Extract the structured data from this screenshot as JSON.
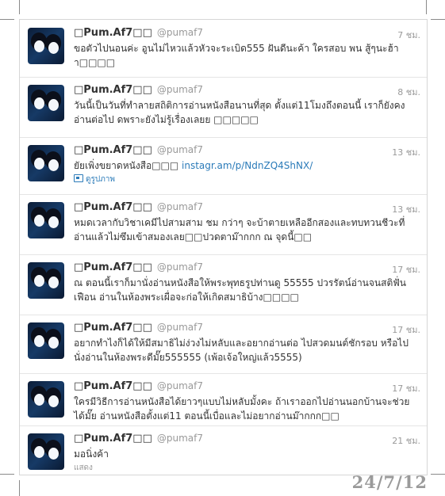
{
  "tweets": [
    {
      "name": "□Pum.Af7□□",
      "handle": "@pumaf7",
      "time": "7 ชม.",
      "text": "ขอตัวไปนอนค่ะ อูนไม่ไหวแล้วหัวจะระเบิด555 ฝันดีนะค้า ใครสอบ พน สู้ๆนะฮ้าา□□□□"
    },
    {
      "name": "□Pum.Af7□□",
      "handle": "@pumaf7",
      "time": "8 ชม.",
      "text": "วันนี้เป็นวันที่ทำลายสถิติการอ่านหนังสือนานที่สุด ตั้งแต่11โมงถึงตอนนี้ เราก็ยังคงอ่านต่อไป ดพราะยังไม่รู้เรื่องเลยย □□□□□"
    },
    {
      "name": "□Pum.Af7□□",
      "handle": "@pumaf7",
      "time": "13 ชม.",
      "text": "ยัยเพิ่งขยาดหนังสือ□□□ ",
      "link": "instagr.am/p/NdnZQ4ShNX/",
      "meta": "ดูรูปภาพ"
    },
    {
      "name": "□Pum.Af7□□",
      "handle": "@pumaf7",
      "time": "13 ชม.",
      "text": "หมดเวลากับวิชาเคมีไปสามสาม ชม กว่าๆ จะบ้าตายเหลืออีกสองและทบทวนชีวะที่อ่านแล้วไม่ซึมเข้าสมองเลย□□ปวดตาม๊ากกก ณ จุดนี้□□"
    },
    {
      "name": "□Pum.Af7□□",
      "handle": "@pumaf7",
      "time": "17 ชม.",
      "text": "ณ ตอนนี้เราก็มานั่งอ่านหนังสือให้พระพุทธรูปท่านดู 55555 ปวรรัตน์อ่านจนสติฟั่นเฟือน อ่านในห้องพระเผื่อจะก่อให้เกิดสมาธิบ้าง□□□□"
    },
    {
      "name": "□Pum.Af7□□",
      "handle": "@pumaf7",
      "time": "17 ชม.",
      "text": "อยากทำไงก็ได้ให้มีสมาธิไม่ง่วงไม่หลับและอยากอ่านต่อ ไปสวดมนต์ชักรอบ หรือไปนั่งอ่านในห้องพระดีมั๊ย555555 (เพ้อเจ้อใหญ่แล้ว5555)"
    },
    {
      "name": "□Pum.Af7□□",
      "handle": "@pumaf7",
      "time": "17 ชม.",
      "text": "ใครมีวิธีการอ่านหนังสือได้ยาวๆแบบไม่หลับมั้งคะ ถ้าเราออกไปอ่านนอกบ้านจะช่วยได้มั๊ย อ่านหนังสือตั้งแต่11 ตอนนี้เบื่อและไม่อยากอ่านม๊ากกก□□"
    },
    {
      "name": "□Pum.Af7□□",
      "handle": "@pumaf7",
      "time": "21 ชม.",
      "text": "มอนิ่งค้า",
      "meta": "แสดง"
    }
  ],
  "date_stamp": "24/7/12"
}
